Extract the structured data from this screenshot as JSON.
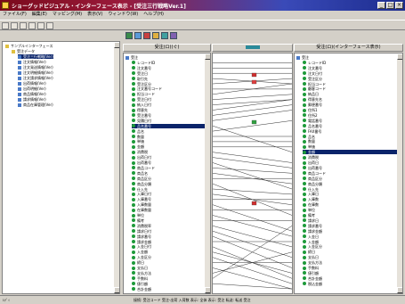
{
  "title": "ショーグッドビジュアル・インターフェース表示 - [受注三行戦略Ver.1]",
  "menu": [
    "ファイル(F)",
    "編集(E)",
    "マッピング(M)",
    "表示(V)",
    "ウィンドウ(W)",
    "ヘルプ(H)"
  ],
  "tree": [
    {
      "label": "サンプルインターフェース",
      "level": 0,
      "icon": "folder"
    },
    {
      "label": "受注データ",
      "level": 1,
      "icon": "folder"
    },
    {
      "label": "受注三行戦略(Ver)",
      "level": 2,
      "icon": "table",
      "selected": true
    },
    {
      "label": "注文情報(Ver)",
      "level": 2,
      "icon": "table"
    },
    {
      "label": "注文発送情報(Ver)",
      "level": 2,
      "icon": "table"
    },
    {
      "label": "注文明細情報(Ver)",
      "level": 2,
      "icon": "table"
    },
    {
      "label": "注文請求情報(Ver)",
      "level": 2,
      "icon": "table"
    },
    {
      "label": "出荷情報(Ver)",
      "level": 2,
      "icon": "table"
    },
    {
      "label": "出荷明細(Ver)",
      "level": 2,
      "icon": "table"
    },
    {
      "label": "商品情報(Ver)",
      "level": 2,
      "icon": "table"
    },
    {
      "label": "請求情報(Ver)",
      "level": 2,
      "icon": "table"
    },
    {
      "label": "商品在庫管理(Ver)",
      "level": 2,
      "icon": "table"
    }
  ],
  "source_header": "受注(ロ)(ぐ)",
  "target_header": "受注(ロ)(インターフェース表示)",
  "mapping_header_icon": "arrows-icon",
  "source_fields": [
    "受注",
    "レコードID",
    "注文番号",
    "受注日",
    "取引先",
    "受注区分",
    "注文番号コード",
    "担当コード",
    "受注日付",
    "納入日付",
    "得意先",
    "受注番号",
    "見積日付",
    "品名番号",
    "品名",
    "数量",
    "単価",
    "金額",
    "消費税",
    "出荷日付",
    "出荷番号",
    "商品コード",
    "商品名",
    "商品区分",
    "商品分類",
    "仕入先",
    "入庫日付",
    "入庫番号",
    "入庫数量",
    "在庫数量",
    "単位",
    "備考",
    "消費税率",
    "請求日付",
    "請求番号",
    "請求金額",
    "入金日付",
    "入金額",
    "入金区分",
    "締日",
    "支払日",
    "支払方法",
    "手数料",
    "値引額",
    "合計金額"
  ],
  "source_selected_index": 13,
  "target_fields": [
    "受注",
    "レコードID",
    "注文番号",
    "注文日付",
    "受注区分",
    "担当コード",
    "顧客コード",
    "納品日",
    "得意先名",
    "郵便番号",
    "住所1",
    "住所2",
    "電話番号",
    "品名番号",
    "FAX番号",
    "品名",
    "数量",
    "単価",
    "金額",
    "消費税",
    "出荷日",
    "出荷番号",
    "商品コード",
    "商品区分",
    "商品分類",
    "仕入先",
    "入庫日",
    "入庫数",
    "在庫数",
    "単位",
    "備考",
    "請求日",
    "請求番号",
    "請求金額",
    "入金日",
    "入金額",
    "入金区分",
    "締日",
    "支払日",
    "支払方法",
    "手数料",
    "値引額",
    "合計金額",
    "税込金額"
  ],
  "target_selected_index": 18,
  "status": {
    "left": "ﾚﾃﾞｨ",
    "right": "接続: 受注コード  受注-出荷 入荷数  表示: 全体  表示: 受注  転送: 転送  受注"
  }
}
